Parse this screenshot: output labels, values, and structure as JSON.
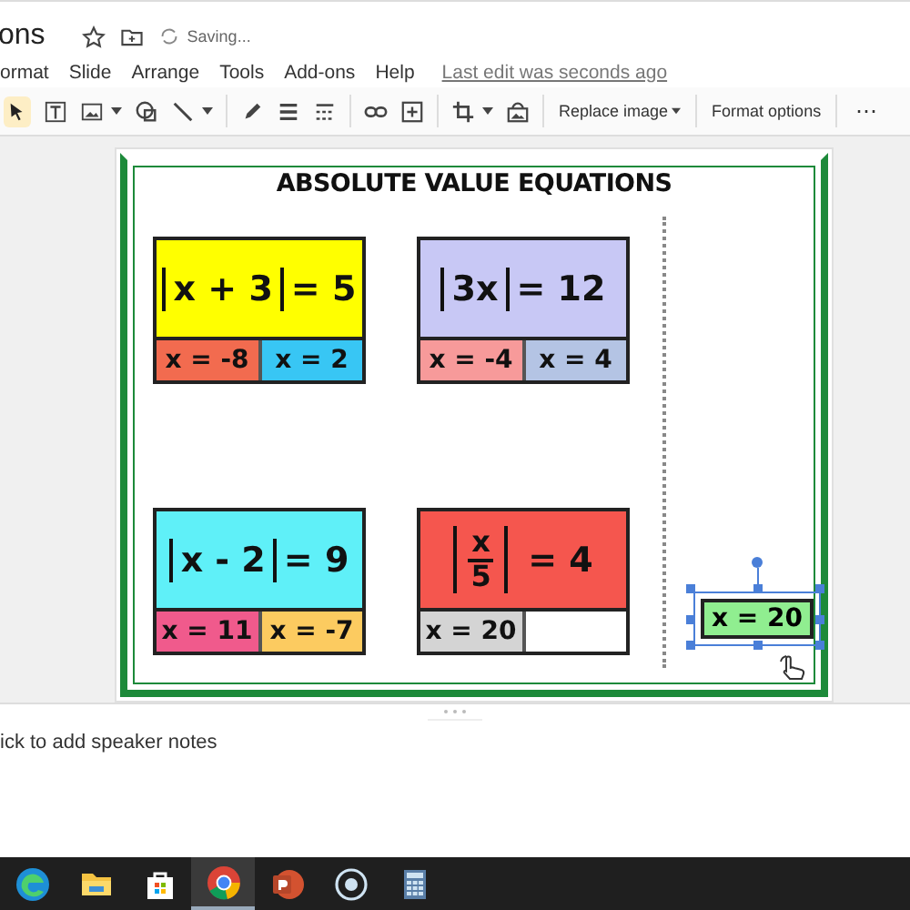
{
  "doc_title": "ons",
  "saving": "Saving...",
  "menu": [
    "ormat",
    "Slide",
    "Arrange",
    "Tools",
    "Add-ons",
    "Help"
  ],
  "last_edit": "Last edit was seconds ago",
  "toolbar": {
    "replace_image": "Replace image",
    "format_options": "Format options",
    "more": "⋯"
  },
  "slide": {
    "title": "ABSOLUTE VALUE EQUATIONS",
    "cards": [
      {
        "kind": "plain",
        "inside": "x + 3",
        "rhs": "= 5",
        "color": "#ffff00",
        "answers": [
          {
            "text": "x = -8",
            "color": "#f26b4f"
          },
          {
            "text": "x = 2",
            "color": "#38c6f4"
          }
        ],
        "empty_slot": false
      },
      {
        "kind": "plain",
        "inside": "3x",
        "rhs": "= 12",
        "color": "#c8c8f5",
        "answers": [
          {
            "text": "x = -4",
            "color": "#f79a9a"
          },
          {
            "text": "x = 4",
            "color": "#b4c4e4"
          }
        ],
        "empty_slot": false
      },
      {
        "kind": "plain",
        "inside": "x - 2",
        "rhs": "= 9",
        "color": "#5ff0f8",
        "answers": [
          {
            "text": "x = 11",
            "color": "#f05a8c"
          },
          {
            "text": "x = -7",
            "color": "#fccb60"
          }
        ],
        "empty_slot": false
      },
      {
        "kind": "fraction",
        "numerator": "x",
        "denominator": "5",
        "rhs": "= 4",
        "color": "#f5564e",
        "answers": [
          {
            "text": "x = 20",
            "color": "#d4d4d4"
          }
        ],
        "empty_slot": true
      }
    ],
    "tile": {
      "text": "x = 20",
      "color": "#90ee90",
      "selected": true
    }
  },
  "notes": "ick to add speaker notes"
}
